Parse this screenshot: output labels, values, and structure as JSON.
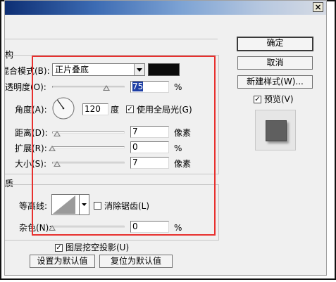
{
  "window": {
    "close_glyph": "×"
  },
  "structure": {
    "heading_partial": "构",
    "blend_mode_label": "混合模式(B):",
    "blend_mode_value": "正片叠底",
    "shadow_color": "#0b0b0b",
    "opacity_label": "透明度(O):",
    "opacity_value": "75",
    "opacity_unit": "%",
    "opacity_level": 0.75,
    "angle_label": "角度(A):",
    "angle_value": "120",
    "angle_unit": "度",
    "global_light_label": "使用全局光(G)",
    "global_light_checked": "✓",
    "distance_label": "距离(D):",
    "distance_value": "7",
    "distance_unit": "像素",
    "spread_label": "扩展(R):",
    "spread_value": "0",
    "spread_unit": "%",
    "size_label": "大小(S):",
    "size_value": "7",
    "size_unit": "像素"
  },
  "quality": {
    "heading_partial": "质",
    "contour_label": "等高线:",
    "anti_alias_label": "消除锯齿(L)",
    "noise_label": "杂色(N):",
    "noise_value": "0",
    "noise_unit": "%"
  },
  "footer": {
    "knockout_label": "图层挖空投影(U)",
    "knockout_checked": "✓",
    "make_default_label": "设置为默认值",
    "reset_default_label": "复位为默认值"
  },
  "side": {
    "ok_label": "确定",
    "cancel_label": "取消",
    "new_style_label": "新建样式(W)...",
    "preview_label": "预览(V)",
    "preview_checked": "✓"
  }
}
